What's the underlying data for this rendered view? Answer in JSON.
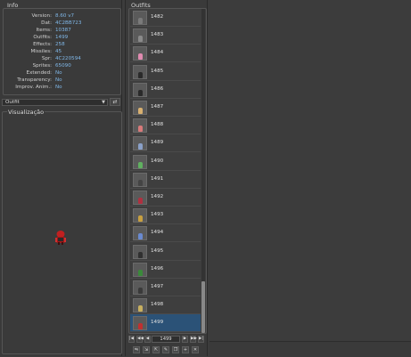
{
  "info": {
    "title": "Info",
    "rows": [
      {
        "key": "Version:",
        "value": "8.60 v7"
      },
      {
        "key": "Dat:",
        "value": "4C2BB723"
      },
      {
        "key": "Items:",
        "value": "10387"
      },
      {
        "key": "Outfits:",
        "value": "1499"
      },
      {
        "key": "Effects:",
        "value": "258"
      },
      {
        "key": "Missiles:",
        "value": "45"
      },
      {
        "key": "Spr:",
        "value": "4C220594"
      },
      {
        "key": "Sprites:",
        "value": "65090"
      },
      {
        "key": "Extended:",
        "value": "No"
      },
      {
        "key": "Transparency:",
        "value": "No"
      },
      {
        "key": "Improv. Anim.:",
        "value": "No"
      }
    ]
  },
  "category": {
    "selected": "Outfit",
    "button_icon": "swap-icon"
  },
  "visualization": {
    "title": "Visualização"
  },
  "outfits": {
    "title": "Outfits",
    "items": [
      {
        "id": "1482",
        "color": "#7a7a7a"
      },
      {
        "id": "1483",
        "color": "#8a8a8a"
      },
      {
        "id": "1484",
        "color": "#e08bb0"
      },
      {
        "id": "1485",
        "color": "#2a2a2a"
      },
      {
        "id": "1486",
        "color": "#2a2a2a"
      },
      {
        "id": "1487",
        "color": "#d8b070"
      },
      {
        "id": "1488",
        "color": "#d87a7a"
      },
      {
        "id": "1489",
        "color": "#8aa0c8"
      },
      {
        "id": "1490",
        "color": "#60b060"
      },
      {
        "id": "1491",
        "color": "#444444"
      },
      {
        "id": "1492",
        "color": "#b03040"
      },
      {
        "id": "1493",
        "color": "#c8a040"
      },
      {
        "id": "1494",
        "color": "#6a8ad0"
      },
      {
        "id": "1495",
        "color": "#303030"
      },
      {
        "id": "1496",
        "color": "#3a8a3a"
      },
      {
        "id": "1497",
        "color": "#3a3a3a"
      },
      {
        "id": "1498",
        "color": "#c8b060"
      },
      {
        "id": "1499",
        "color": "#c03030"
      }
    ],
    "selected_id": "1499",
    "page_value": "1499",
    "nav": [
      "first-icon",
      "prev-page-icon",
      "prev-icon",
      "next-icon",
      "next-page-icon",
      "last-icon"
    ],
    "tools": [
      "replace-icon",
      "import-icon",
      "export-icon",
      "edit-icon",
      "duplicate-icon",
      "new-icon",
      "delete-icon"
    ]
  }
}
